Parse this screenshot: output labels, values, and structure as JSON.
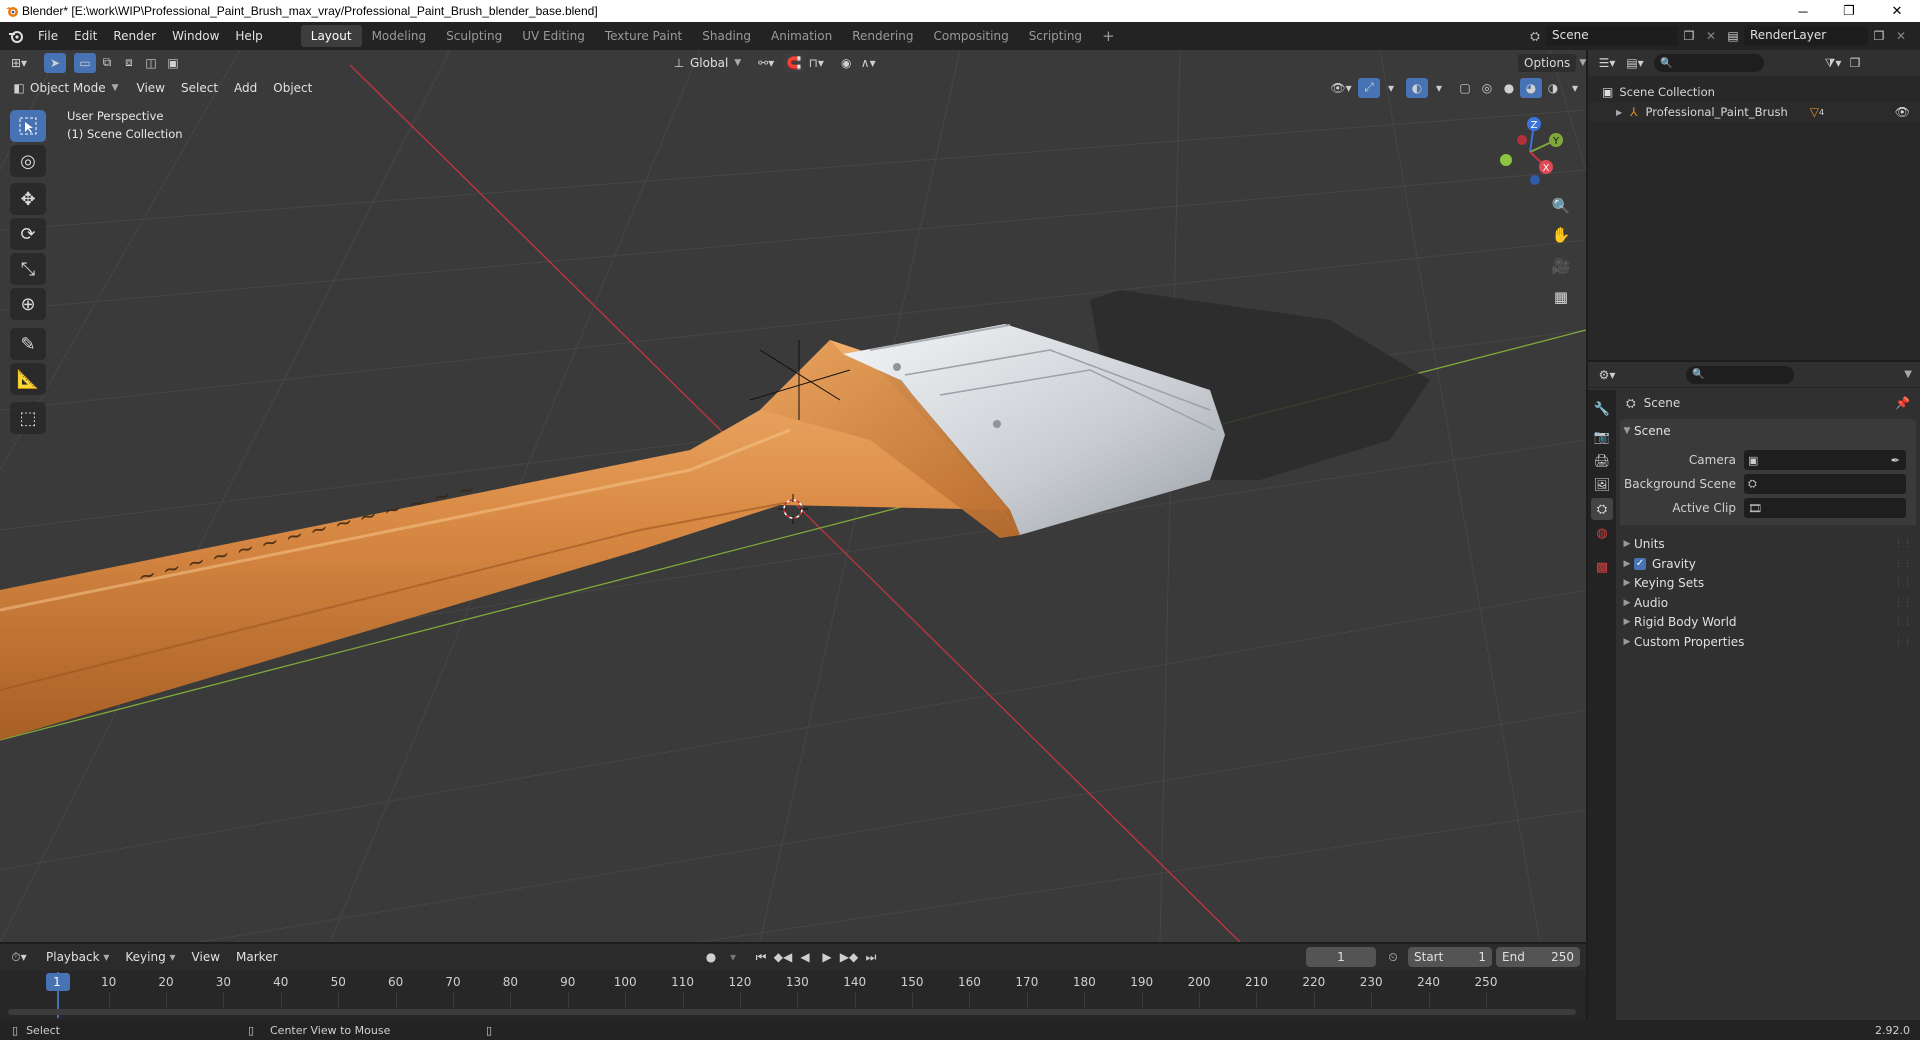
{
  "window": {
    "title": "Blender* [E:\\work\\WIP\\Professional_Paint_Brush_max_vray/Professional_Paint_Brush_blender_base.blend]",
    "minimize": "─",
    "restore": "❐",
    "close": "✕"
  },
  "menus": [
    "File",
    "Edit",
    "Render",
    "Window",
    "Help"
  ],
  "workspaces": [
    "Layout",
    "Modeling",
    "Sculpting",
    "UV Editing",
    "Texture Paint",
    "Shading",
    "Animation",
    "Rendering",
    "Compositing",
    "Scripting"
  ],
  "active_workspace": "Layout",
  "add_workspace": "+",
  "scene_selector": {
    "value": "Scene"
  },
  "view_layer_selector": {
    "value": "RenderLayer"
  },
  "viewport": {
    "mode": "Object Mode",
    "menus": [
      "View",
      "Select",
      "Add",
      "Object"
    ],
    "transform_orientation": "Global",
    "options_label": "Options",
    "overlay_text": [
      "User Perspective",
      "(1) Scene Collection"
    ],
    "gizmo_axes": {
      "x": "X",
      "y": "Y",
      "z": "Z"
    },
    "colors": {
      "background": "#3a3a3a",
      "x_axis": "#c0353f",
      "y_axis": "#7fa83a",
      "grid": "#474747"
    }
  },
  "outliner": {
    "root": "Scene Collection",
    "items": [
      {
        "label": "Professional_Paint_Brush",
        "badge": "4"
      }
    ]
  },
  "properties": {
    "context": "Scene",
    "section": "Scene",
    "fields": [
      {
        "label": "Camera",
        "value": ""
      },
      {
        "label": "Background Scene",
        "value": ""
      },
      {
        "label": "Active Clip",
        "value": ""
      }
    ],
    "panels": [
      {
        "label": "Units",
        "checkbox": false
      },
      {
        "label": "Gravity",
        "checkbox": true,
        "checked": true
      },
      {
        "label": "Keying Sets",
        "checkbox": false
      },
      {
        "label": "Audio",
        "checkbox": false
      },
      {
        "label": "Rigid Body World",
        "checkbox": false
      },
      {
        "label": "Custom Properties",
        "checkbox": false
      }
    ]
  },
  "timeline": {
    "menus": [
      "Playback",
      "Keying",
      "View",
      "Marker"
    ],
    "current_frame": "1",
    "start_label": "Start",
    "start_value": "1",
    "end_label": "End",
    "end_value": "250",
    "ruler": [
      "1",
      "10",
      "20",
      "30",
      "40",
      "50",
      "60",
      "70",
      "80",
      "90",
      "100",
      "110",
      "120",
      "130",
      "140",
      "150",
      "160",
      "170",
      "180",
      "190",
      "200",
      "210",
      "220",
      "230",
      "240",
      "250"
    ]
  },
  "statusbar": {
    "left": "Select",
    "middle": "Center View to Mouse",
    "version": "2.92.0"
  },
  "accent_color": "#4772b3"
}
